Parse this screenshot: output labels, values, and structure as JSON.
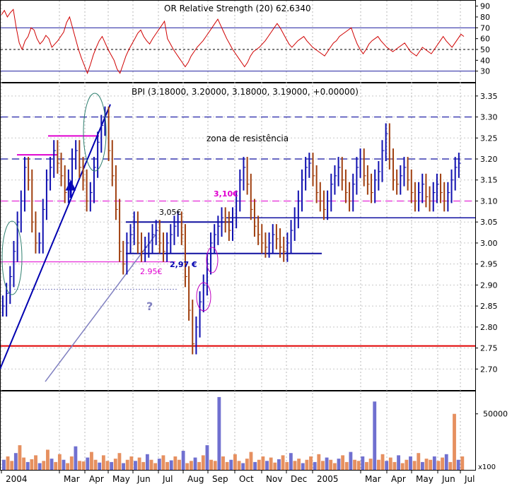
{
  "chart_data": [
    {
      "type": "line",
      "panel": "indicator",
      "title": "OR Relative Strength (20) 62.6340",
      "ylim": [
        20,
        95
      ],
      "yticks": [
        30,
        40,
        50,
        60,
        70,
        80,
        90
      ],
      "reference_lines": [
        70,
        50,
        30
      ],
      "series": [
        {
          "color": "#d00000",
          "values": [
            82,
            86,
            80,
            84,
            87,
            70,
            56,
            50,
            58,
            62,
            70,
            68,
            60,
            55,
            58,
            63,
            60,
            52,
            55,
            58,
            62,
            66,
            75,
            80,
            70,
            60,
            50,
            42,
            35,
            28,
            36,
            45,
            52,
            58,
            62,
            56,
            50,
            45,
            40,
            32,
            28,
            36,
            44,
            50,
            55,
            60,
            65,
            68,
            62,
            58,
            55,
            60,
            64,
            68,
            72,
            76,
            60,
            55,
            50,
            46,
            42,
            38,
            34,
            38,
            44,
            48,
            52,
            55,
            58,
            62,
            66,
            70,
            74,
            78,
            72,
            66,
            60,
            55,
            50,
            46,
            42,
            38,
            34,
            38,
            44,
            48,
            50,
            52,
            55,
            58,
            62,
            66,
            70,
            74,
            70,
            65,
            60,
            55,
            52,
            55,
            58,
            60,
            62,
            58,
            55,
            52,
            50,
            48,
            46,
            44,
            48,
            52,
            56,
            58,
            62,
            64,
            66,
            68,
            70,
            62,
            55,
            50,
            46,
            50,
            55,
            58,
            60,
            62,
            58,
            55,
            52,
            50,
            48,
            50,
            52,
            54,
            56,
            52,
            48,
            46,
            44,
            48,
            52,
            50,
            48,
            46,
            50,
            54,
            58,
            62,
            58,
            55,
            52,
            56,
            60,
            64,
            62
          ]
        }
      ]
    },
    {
      "type": "candlestick",
      "panel": "price",
      "title": "BPI (3.18000, 3.20000, 3.18000, 3.19000, +0.00000)",
      "ylim": [
        2.65,
        3.38
      ],
      "yticks": [
        2.7,
        2.75,
        2.8,
        2.85,
        2.9,
        2.95,
        3.0,
        3.05,
        3.1,
        3.15,
        3.2,
        3.25,
        3.3,
        3.35
      ],
      "close_series": [
        2.85,
        2.88,
        2.92,
        2.98,
        3.05,
        3.1,
        3.18,
        3.15,
        3.05,
        3.0,
        3.0,
        3.08,
        3.15,
        3.18,
        3.22,
        3.19,
        3.16,
        3.12,
        3.15,
        3.2,
        3.22,
        3.18,
        3.15,
        3.1,
        3.12,
        3.18,
        3.24,
        3.28,
        3.3,
        3.22,
        3.16,
        3.08,
        2.98,
        2.95,
        3.0,
        3.02,
        3.05,
        3.0,
        2.98,
        2.99,
        3.0,
        3.02,
        3.03,
        3.0,
        2.98,
        3.0,
        3.02,
        3.04,
        3.05,
        3.02,
        2.92,
        2.84,
        2.76,
        2.8,
        2.86,
        2.9,
        2.95,
        3.0,
        3.02,
        3.04,
        3.06,
        3.05,
        3.03,
        3.06,
        3.1,
        3.15,
        3.18,
        3.14,
        3.08,
        3.04,
        3.02,
        3.0,
        2.99,
        3.0,
        3.02,
        3.01,
        2.99,
        2.98,
        3.0,
        3.03,
        3.06,
        3.1,
        3.15,
        3.18,
        3.19,
        3.16,
        3.12,
        3.1,
        3.08,
        3.1,
        3.14,
        3.16,
        3.18,
        3.15,
        3.12,
        3.1,
        3.14,
        3.18,
        3.2,
        3.16,
        3.14,
        3.12,
        3.15,
        3.17,
        3.22,
        3.26,
        3.2,
        3.15,
        3.14,
        3.16,
        3.18,
        3.15,
        3.12,
        3.1,
        3.12,
        3.14,
        3.11,
        3.1,
        3.12,
        3.14,
        3.12,
        3.1,
        3.12,
        3.15,
        3.18,
        3.19
      ],
      "x_labels": [
        "2004",
        "Mar",
        "Apr",
        "May",
        "Jun",
        "Jul",
        "Aug",
        "Sep",
        "Oct",
        "Nov",
        "Dec",
        "2005",
        "Mar",
        "Apr",
        "May",
        "Jun",
        "Jul"
      ],
      "annotations": [
        "zona de resistência",
        "3,10€",
        "3,05€",
        "2,97 €",
        "2.95€",
        "?"
      ],
      "horizontal_lines": [
        3.3,
        3.2,
        3.1,
        3.06,
        2.975,
        2.755
      ]
    },
    {
      "type": "bar",
      "panel": "volume",
      "unit_label": "x100",
      "ytick": "50000",
      "ylim": [
        0,
        70000
      ],
      "series": [
        {
          "color": "#e69060",
          "name": "down"
        },
        {
          "color": "#7070d0",
          "name": "up"
        }
      ],
      "values": [
        9000,
        12000,
        8000,
        15000,
        22000,
        11000,
        7000,
        9500,
        13000,
        6000,
        8000,
        18000,
        10000,
        7000,
        14000,
        9000,
        6000,
        12000,
        21000,
        8000,
        7500,
        11000,
        16000,
        9000,
        6500,
        13000,
        8000,
        7000,
        10000,
        15000,
        6000,
        9000,
        12000,
        8000,
        11000,
        7000,
        14000,
        9000,
        6000,
        10000,
        13000,
        7000,
        8500,
        12000,
        9000,
        17000,
        6000,
        8000,
        11000,
        7000,
        13000,
        22000,
        9000,
        8000,
        65000,
        12000,
        7000,
        9000,
        14000,
        8000,
        6000,
        10000,
        16000,
        7000,
        9000,
        12000,
        8000,
        11000,
        6500,
        9500,
        13000,
        7000,
        15000,
        8000,
        10000,
        6000,
        9000,
        12000,
        7000,
        14000,
        8000,
        11000,
        9000,
        6000,
        10000,
        13000,
        7000,
        16000,
        9000,
        8000,
        12000,
        7000,
        10000,
        61000,
        9000,
        14000,
        8000,
        11000,
        7000,
        13000,
        6000,
        9000,
        12000,
        8000,
        15000,
        7000,
        10000,
        9000,
        12000,
        8000,
        11000,
        14000,
        7000,
        50000,
        9000,
        12000
      ]
    }
  ]
}
